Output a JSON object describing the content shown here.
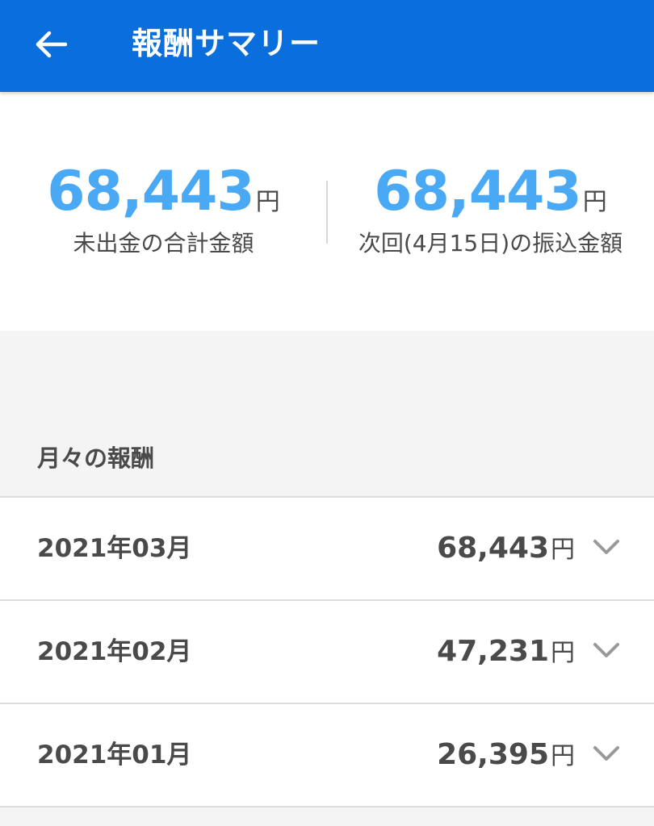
{
  "header": {
    "title": "報酬サマリー",
    "back_icon": "arrow-left-icon",
    "background_color": "#0a6fdc"
  },
  "summary": {
    "unpaid_total": {
      "value": "68,443",
      "unit": "円",
      "caption": "未出金の合計金額"
    },
    "next_transfer": {
      "value": "68,443",
      "unit": "円",
      "caption": "次回(4月15日)の振込金額"
    },
    "accent_color": "#4aa9f4"
  },
  "monthly": {
    "section_title": "月々の報酬",
    "rows": [
      {
        "month": "2021年03月",
        "value": "68,443",
        "unit": "円",
        "icon": "chevron-down-icon"
      },
      {
        "month": "2021年02月",
        "value": "47,231",
        "unit": "円",
        "icon": "chevron-down-icon"
      },
      {
        "month": "2021年01月",
        "value": "26,395",
        "unit": "円",
        "icon": "chevron-down-icon"
      }
    ]
  }
}
